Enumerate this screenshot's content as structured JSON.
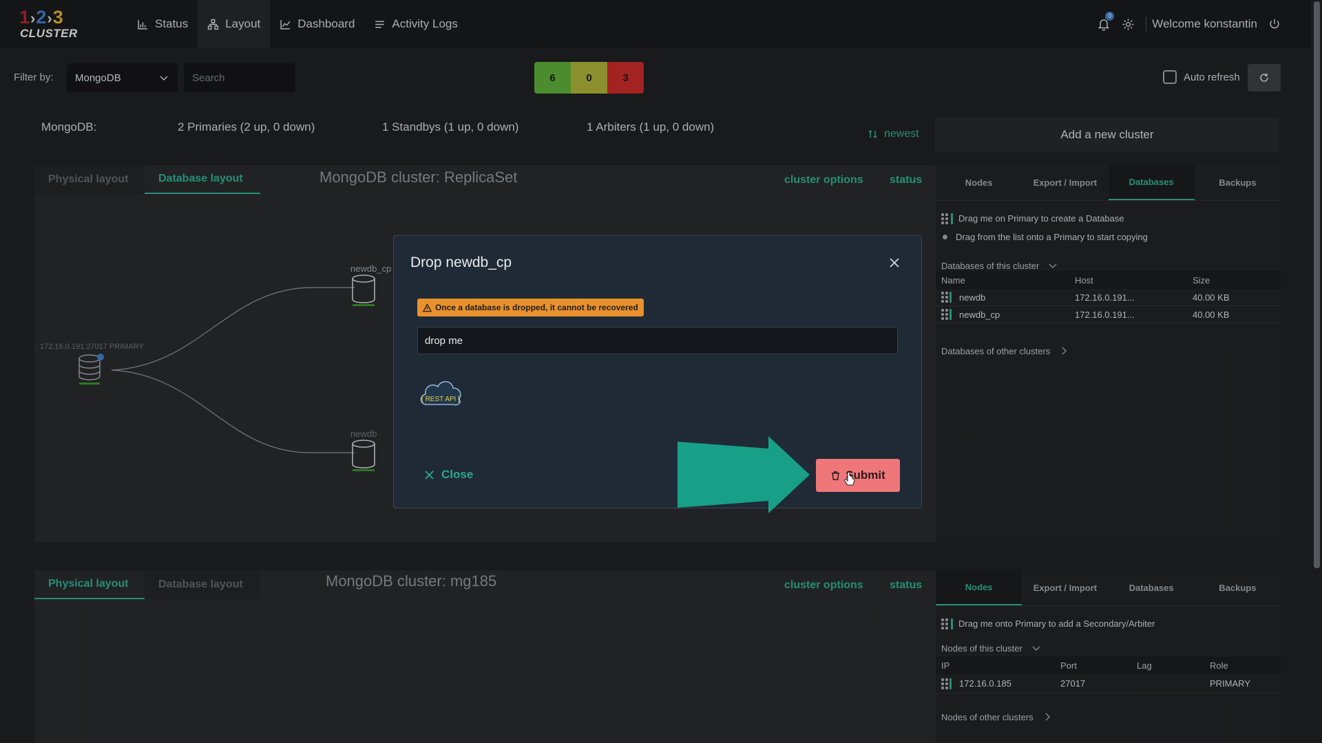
{
  "app": {
    "logo_numbers": [
      "1",
      "2",
      "3"
    ],
    "logo_word": "CLUSTER"
  },
  "nav": {
    "items": [
      {
        "label": "Status",
        "icon": "bar-chart-icon"
      },
      {
        "label": "Layout",
        "icon": "hierarchy-icon"
      },
      {
        "label": "Dashboard",
        "icon": "line-chart-icon"
      },
      {
        "label": "Activity Logs",
        "icon": "list-icon"
      }
    ],
    "active": "Layout",
    "notifications_count": "0",
    "welcome": "Welcome konstantin"
  },
  "filter": {
    "label": "Filter by:",
    "selected": "MongoDB",
    "search_placeholder": "Search",
    "counts": [
      {
        "value": "6",
        "color": "#5aa537"
      },
      {
        "value": "0",
        "color": "#a5a935"
      },
      {
        "value": "3",
        "color": "#c02a28"
      }
    ],
    "auto_refresh_label": "Auto refresh"
  },
  "summary": {
    "label": "MongoDB:",
    "primaries": "2 Primaries (2 up, 0 down)",
    "standbys": "1 Standbys (1 up, 0 down)",
    "arbiters": "1 Arbiters (1 up, 0 down)",
    "sort_label": "newest",
    "add_cluster": "Add a new cluster"
  },
  "cluster1": {
    "tabs": [
      "Physical layout",
      "Database layout"
    ],
    "active_tab": "Database layout",
    "title": "MongoDB cluster: ReplicaSet",
    "options_label": "cluster options",
    "status_label": "status",
    "primary_node_label": "172.16.0.191:27017 PRIMARY",
    "db_nodes": [
      "newdb_cp",
      "newdb"
    ],
    "side": {
      "tabs": [
        "Nodes",
        "Export / Import",
        "Databases",
        "Backups"
      ],
      "active_tab": "Databases",
      "hint1": "Drag me on Primary to create a Database",
      "hint2": "Drag from the list onto a Primary to start copying",
      "section_this": "Databases of this cluster",
      "columns": [
        "Name",
        "Host",
        "Size"
      ],
      "rows": [
        [
          "newdb",
          "172.16.0.191...",
          "40.00 KB"
        ],
        [
          "newdb_cp",
          "172.16.0.191...",
          "40.00 KB"
        ]
      ],
      "section_other": "Databases of other clusters"
    }
  },
  "cluster2": {
    "tabs": [
      "Physical layout",
      "Database layout"
    ],
    "active_tab": "Physical layout",
    "title": "MongoDB cluster: mg185",
    "options_label": "cluster options",
    "status_label": "status",
    "side": {
      "tabs": [
        "Nodes",
        "Export / Import",
        "Databases",
        "Backups"
      ],
      "active_tab": "Nodes",
      "hint": "Drag me onto Primary to add a Secondary/Arbiter",
      "section_this": "Nodes of this cluster",
      "columns": [
        "IP",
        "Port",
        "Lag",
        "Role"
      ],
      "rows": [
        [
          "172.16.0.185",
          "27017",
          "",
          "PRIMARY"
        ]
      ],
      "section_other": "Nodes of other clusters"
    }
  },
  "modal": {
    "title": "Drop newdb_cp",
    "warning": "Once a database is dropped, it cannot be recovered",
    "confirm_value": "drop me",
    "rest_api_label": "{ REST API }",
    "close_label": "Close",
    "submit_label": "Submit",
    "arrow_color": "#17a087"
  }
}
